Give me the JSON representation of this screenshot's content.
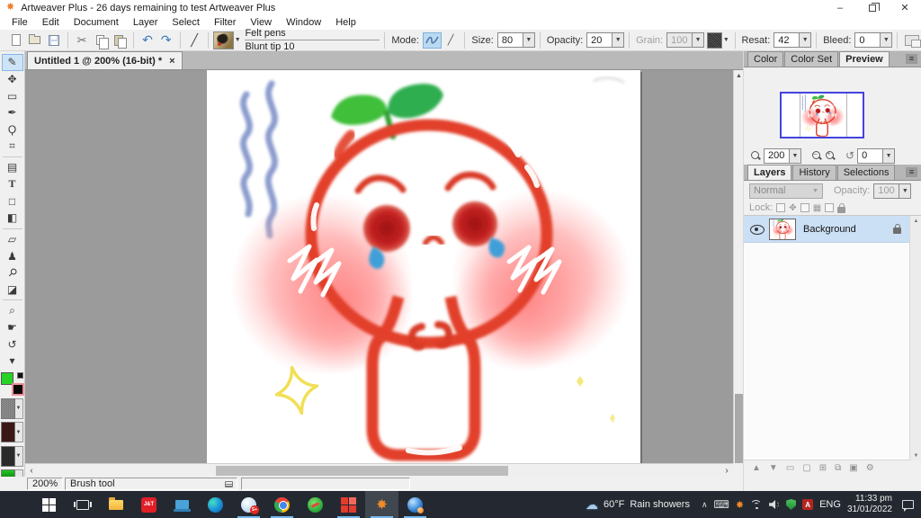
{
  "titlebar": {
    "title": "Artweaver Plus - 26 days remaining to test Artweaver Plus"
  },
  "menu": {
    "items": [
      "File",
      "Edit",
      "Document",
      "Layer",
      "Select",
      "Filter",
      "View",
      "Window",
      "Help"
    ]
  },
  "toolbar": {
    "brush_category": "Felt pens",
    "brush_name": "Blunt tip 10",
    "mode_label": "Mode:",
    "size_label": "Size:",
    "size_value": "80",
    "opacity_label": "Opacity:",
    "opacity_value": "20",
    "grain_label": "Grain:",
    "grain_value": "100",
    "resat_label": "Resat:",
    "resat_value": "42",
    "bleed_label": "Bleed:",
    "bleed_value": "0"
  },
  "document": {
    "tab_label": "Untitled 1 @ 200% (16-bit) *",
    "close_glyph": "×"
  },
  "tools": [
    {
      "name": "brush",
      "glyph": "✎"
    },
    {
      "name": "move",
      "glyph": "✥"
    },
    {
      "name": "rect-select",
      "glyph": "▭"
    },
    {
      "name": "pen",
      "glyph": "✒"
    },
    {
      "name": "lasso",
      "glyph": "Ϙ"
    },
    {
      "name": "crop",
      "glyph": "⌗"
    },
    {
      "name": "pattern",
      "glyph": "▤"
    },
    {
      "name": "text",
      "glyph": "T"
    },
    {
      "name": "shape",
      "glyph": "□"
    },
    {
      "name": "gradient",
      "glyph": "◧"
    },
    {
      "name": "eraser",
      "glyph": "▱"
    },
    {
      "name": "stamp",
      "glyph": "♟"
    },
    {
      "name": "eyedropper",
      "glyph": "⚲"
    },
    {
      "name": "fill",
      "glyph": "◪"
    },
    {
      "name": "zoom",
      "glyph": "⌕"
    },
    {
      "name": "hand",
      "glyph": "☛"
    },
    {
      "name": "rotate",
      "glyph": "↺"
    },
    {
      "name": "more",
      "glyph": "▾"
    }
  ],
  "right_panel": {
    "top_tabs": [
      "Color",
      "Color Set",
      "Preview"
    ],
    "preview_zoom": "200",
    "preview_rotation": "0",
    "panel_tabs": [
      "Layers",
      "History",
      "Selections"
    ],
    "blend_mode": "Normal",
    "opacity_label": "Opacity:",
    "opacity_value": "100",
    "lock_label": "Lock:",
    "layers": [
      {
        "name": "Background"
      }
    ],
    "bottom_buttons": [
      "▲",
      "▼",
      "▭",
      "▢",
      "⊞",
      "⧉",
      "▣",
      "⚙"
    ]
  },
  "status": {
    "zoom": "200%",
    "tool": "Brush tool"
  },
  "taskbar": {
    "apps": [
      {
        "name": "start"
      },
      {
        "name": "task-view"
      },
      {
        "name": "file-explorer"
      },
      {
        "name": "jt-app",
        "label": "J&T"
      },
      {
        "name": "device-app"
      },
      {
        "name": "edge"
      },
      {
        "name": "share-app",
        "badge": "S+"
      },
      {
        "name": "chrome"
      },
      {
        "name": "green-app"
      },
      {
        "name": "red-grid-app"
      },
      {
        "name": "artweaver",
        "active": true
      },
      {
        "name": "browser-app"
      }
    ],
    "weather_temp": "60°F",
    "weather_condition": "Rain showers",
    "language": "ENG",
    "time": "11:33 pm",
    "date": "31/01/2022"
  },
  "colors": {
    "selection_blue": "#cde4f7",
    "taskbar_underline": "#76b9ed",
    "canvas_red": "#e2402a",
    "leaf_green": "#3ec437",
    "blush_pink": "#ff8d8d",
    "wave_blue": "#8b9cce",
    "tear_blue": "#3f9fd8",
    "sparkle_yellow": "#f2df55",
    "foreground_swatch": "#27d426",
    "background_swatch": "#0a0a0a"
  }
}
